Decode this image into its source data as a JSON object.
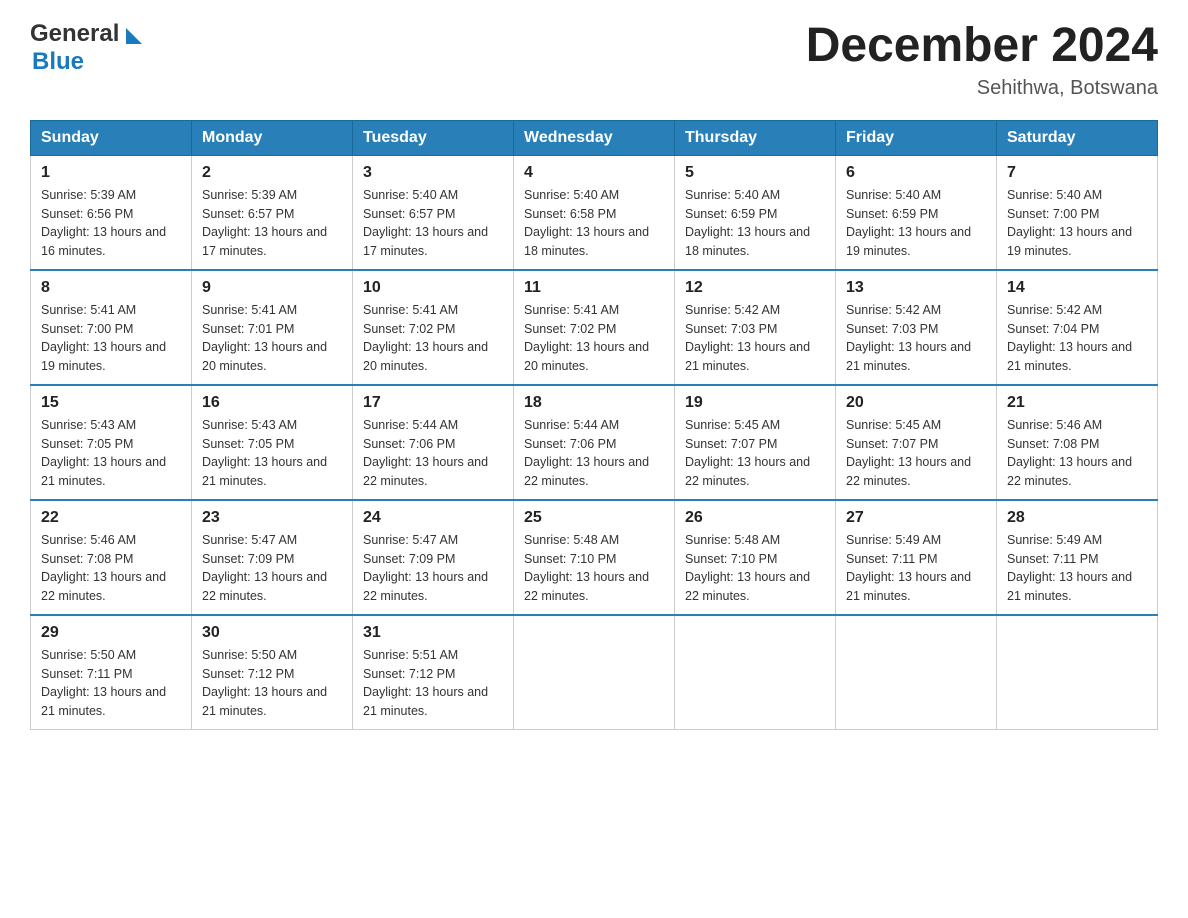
{
  "header": {
    "logo_general": "General",
    "logo_blue": "Blue",
    "title": "December 2024",
    "location": "Sehithwa, Botswana"
  },
  "weekdays": [
    "Sunday",
    "Monday",
    "Tuesday",
    "Wednesday",
    "Thursday",
    "Friday",
    "Saturday"
  ],
  "weeks": [
    [
      {
        "day": "1",
        "sunrise": "Sunrise: 5:39 AM",
        "sunset": "Sunset: 6:56 PM",
        "daylight": "Daylight: 13 hours and 16 minutes."
      },
      {
        "day": "2",
        "sunrise": "Sunrise: 5:39 AM",
        "sunset": "Sunset: 6:57 PM",
        "daylight": "Daylight: 13 hours and 17 minutes."
      },
      {
        "day": "3",
        "sunrise": "Sunrise: 5:40 AM",
        "sunset": "Sunset: 6:57 PM",
        "daylight": "Daylight: 13 hours and 17 minutes."
      },
      {
        "day": "4",
        "sunrise": "Sunrise: 5:40 AM",
        "sunset": "Sunset: 6:58 PM",
        "daylight": "Daylight: 13 hours and 18 minutes."
      },
      {
        "day": "5",
        "sunrise": "Sunrise: 5:40 AM",
        "sunset": "Sunset: 6:59 PM",
        "daylight": "Daylight: 13 hours and 18 minutes."
      },
      {
        "day": "6",
        "sunrise": "Sunrise: 5:40 AM",
        "sunset": "Sunset: 6:59 PM",
        "daylight": "Daylight: 13 hours and 19 minutes."
      },
      {
        "day": "7",
        "sunrise": "Sunrise: 5:40 AM",
        "sunset": "Sunset: 7:00 PM",
        "daylight": "Daylight: 13 hours and 19 minutes."
      }
    ],
    [
      {
        "day": "8",
        "sunrise": "Sunrise: 5:41 AM",
        "sunset": "Sunset: 7:00 PM",
        "daylight": "Daylight: 13 hours and 19 minutes."
      },
      {
        "day": "9",
        "sunrise": "Sunrise: 5:41 AM",
        "sunset": "Sunset: 7:01 PM",
        "daylight": "Daylight: 13 hours and 20 minutes."
      },
      {
        "day": "10",
        "sunrise": "Sunrise: 5:41 AM",
        "sunset": "Sunset: 7:02 PM",
        "daylight": "Daylight: 13 hours and 20 minutes."
      },
      {
        "day": "11",
        "sunrise": "Sunrise: 5:41 AM",
        "sunset": "Sunset: 7:02 PM",
        "daylight": "Daylight: 13 hours and 20 minutes."
      },
      {
        "day": "12",
        "sunrise": "Sunrise: 5:42 AM",
        "sunset": "Sunset: 7:03 PM",
        "daylight": "Daylight: 13 hours and 21 minutes."
      },
      {
        "day": "13",
        "sunrise": "Sunrise: 5:42 AM",
        "sunset": "Sunset: 7:03 PM",
        "daylight": "Daylight: 13 hours and 21 minutes."
      },
      {
        "day": "14",
        "sunrise": "Sunrise: 5:42 AM",
        "sunset": "Sunset: 7:04 PM",
        "daylight": "Daylight: 13 hours and 21 minutes."
      }
    ],
    [
      {
        "day": "15",
        "sunrise": "Sunrise: 5:43 AM",
        "sunset": "Sunset: 7:05 PM",
        "daylight": "Daylight: 13 hours and 21 minutes."
      },
      {
        "day": "16",
        "sunrise": "Sunrise: 5:43 AM",
        "sunset": "Sunset: 7:05 PM",
        "daylight": "Daylight: 13 hours and 21 minutes."
      },
      {
        "day": "17",
        "sunrise": "Sunrise: 5:44 AM",
        "sunset": "Sunset: 7:06 PM",
        "daylight": "Daylight: 13 hours and 22 minutes."
      },
      {
        "day": "18",
        "sunrise": "Sunrise: 5:44 AM",
        "sunset": "Sunset: 7:06 PM",
        "daylight": "Daylight: 13 hours and 22 minutes."
      },
      {
        "day": "19",
        "sunrise": "Sunrise: 5:45 AM",
        "sunset": "Sunset: 7:07 PM",
        "daylight": "Daylight: 13 hours and 22 minutes."
      },
      {
        "day": "20",
        "sunrise": "Sunrise: 5:45 AM",
        "sunset": "Sunset: 7:07 PM",
        "daylight": "Daylight: 13 hours and 22 minutes."
      },
      {
        "day": "21",
        "sunrise": "Sunrise: 5:46 AM",
        "sunset": "Sunset: 7:08 PM",
        "daylight": "Daylight: 13 hours and 22 minutes."
      }
    ],
    [
      {
        "day": "22",
        "sunrise": "Sunrise: 5:46 AM",
        "sunset": "Sunset: 7:08 PM",
        "daylight": "Daylight: 13 hours and 22 minutes."
      },
      {
        "day": "23",
        "sunrise": "Sunrise: 5:47 AM",
        "sunset": "Sunset: 7:09 PM",
        "daylight": "Daylight: 13 hours and 22 minutes."
      },
      {
        "day": "24",
        "sunrise": "Sunrise: 5:47 AM",
        "sunset": "Sunset: 7:09 PM",
        "daylight": "Daylight: 13 hours and 22 minutes."
      },
      {
        "day": "25",
        "sunrise": "Sunrise: 5:48 AM",
        "sunset": "Sunset: 7:10 PM",
        "daylight": "Daylight: 13 hours and 22 minutes."
      },
      {
        "day": "26",
        "sunrise": "Sunrise: 5:48 AM",
        "sunset": "Sunset: 7:10 PM",
        "daylight": "Daylight: 13 hours and 22 minutes."
      },
      {
        "day": "27",
        "sunrise": "Sunrise: 5:49 AM",
        "sunset": "Sunset: 7:11 PM",
        "daylight": "Daylight: 13 hours and 21 minutes."
      },
      {
        "day": "28",
        "sunrise": "Sunrise: 5:49 AM",
        "sunset": "Sunset: 7:11 PM",
        "daylight": "Daylight: 13 hours and 21 minutes."
      }
    ],
    [
      {
        "day": "29",
        "sunrise": "Sunrise: 5:50 AM",
        "sunset": "Sunset: 7:11 PM",
        "daylight": "Daylight: 13 hours and 21 minutes."
      },
      {
        "day": "30",
        "sunrise": "Sunrise: 5:50 AM",
        "sunset": "Sunset: 7:12 PM",
        "daylight": "Daylight: 13 hours and 21 minutes."
      },
      {
        "day": "31",
        "sunrise": "Sunrise: 5:51 AM",
        "sunset": "Sunset: 7:12 PM",
        "daylight": "Daylight: 13 hours and 21 minutes."
      },
      null,
      null,
      null,
      null
    ]
  ]
}
